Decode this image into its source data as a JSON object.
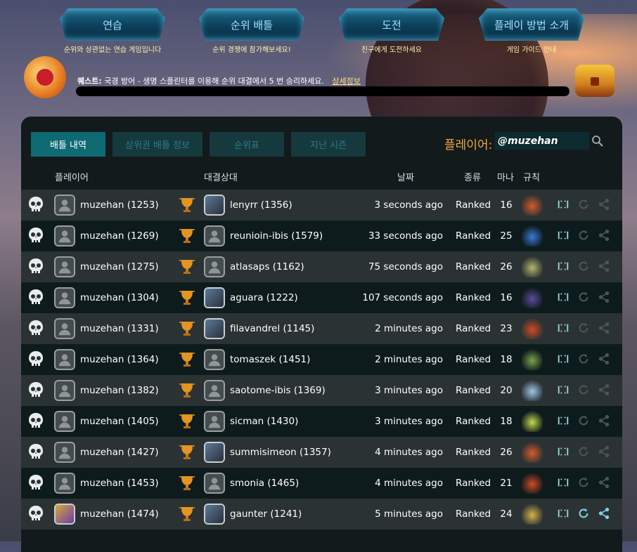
{
  "nav": [
    {
      "label": "연습",
      "sub": "순위와 상관없는 연습 게임입니다"
    },
    {
      "label": "순위 배틀",
      "sub": "순위 경쟁에 참가해보세요!"
    },
    {
      "label": "도전",
      "sub": "친구에게 도전하세요"
    },
    {
      "label": "플레이 방법 소개",
      "sub": "게임 가이드 안내"
    }
  ],
  "quest": {
    "prefix": "퀘스트:",
    "text": "국경 방어 - 생명 스플린터를 이용해 순위 대결에서 5 번 승리하세요.",
    "link": "상세정보"
  },
  "tabs": [
    "배틀 내역",
    "상위권 배틀 정보",
    "순위표",
    "지난 시즌"
  ],
  "player": {
    "label": "플레이어:",
    "value": "@muzehan"
  },
  "headers": {
    "player": "플레이어",
    "opponent": "대결상대",
    "date": "날짜",
    "type": "종류",
    "mana": "마나",
    "rules": "규칙"
  },
  "rows": [
    {
      "player": "muzehan (1253)",
      "opponent": "lenyrr (1356)",
      "date": "3 seconds ago",
      "type": "Ranked",
      "mana": "16",
      "rule_icon": "explosion-icon",
      "rule_color": "#d65a2c",
      "opp_avatar": "castle-avatar"
    },
    {
      "player": "muzehan (1269)",
      "opponent": "reunioin-ibis (1579)",
      "date": "33 seconds ago",
      "type": "Ranked",
      "mana": "25",
      "rule_icon": "cards-icon",
      "rule_color": "#3a7bd5",
      "opp_avatar": "default-avatar"
    },
    {
      "player": "muzehan (1275)",
      "opponent": "atlasaps (1162)",
      "date": "75 seconds ago",
      "type": "Ranked",
      "mana": "26",
      "rule_icon": "claw-icon",
      "rule_color": "#b8b36a",
      "opp_avatar": "default-avatar"
    },
    {
      "player": "muzehan (1304)",
      "opponent": "aguara (1222)",
      "date": "107 seconds ago",
      "type": "Ranked",
      "mana": "16",
      "rule_icon": "hooded-figure-icon",
      "rule_color": "#5e4a9c",
      "opp_avatar": "red-creature-avatar"
    },
    {
      "player": "muzehan (1331)",
      "opponent": "filavandrel (1145)",
      "date": "2 minutes ago",
      "type": "Ranked",
      "mana": "23",
      "rule_icon": "banner-icon",
      "rule_color": "#d34a22",
      "opp_avatar": "feather-avatar"
    },
    {
      "player": "muzehan (1364)",
      "opponent": "tomaszek (1451)",
      "date": "2 minutes ago",
      "type": "Ranked",
      "mana": "18",
      "rule_icon": "goblin-icon",
      "rule_color": "#7aa14a",
      "opp_avatar": "default-avatar"
    },
    {
      "player": "muzehan (1382)",
      "opponent": "saotome-ibis (1369)",
      "date": "3 minutes ago",
      "type": "Ranked",
      "mana": "20",
      "rule_icon": "horned-helmet-icon",
      "rule_color": "#9fc6e6",
      "opp_avatar": "default-avatar"
    },
    {
      "player": "muzehan (1405)",
      "opponent": "sicman (1430)",
      "date": "3 minutes ago",
      "type": "Ranked",
      "mana": "18",
      "rule_icon": "cloak-icon",
      "rule_color": "#c7d94a",
      "opp_avatar": "default-avatar"
    },
    {
      "player": "muzehan (1427)",
      "opponent": "summisimeon (1357)",
      "date": "4 minutes ago",
      "type": "Ranked",
      "mana": "26",
      "rule_icon": "explosion-icon",
      "rule_color": "#d65a2c",
      "opp_avatar": "person-avatar"
    },
    {
      "player": "muzehan (1453)",
      "opponent": "smonia (1465)",
      "date": "4 minutes ago",
      "type": "Ranked",
      "mana": "21",
      "rule_icon": "banner-icon",
      "rule_color": "#d34a22",
      "opp_avatar": "default-avatar"
    },
    {
      "player": "muzehan (1474)",
      "opponent": "gaunter (1241)",
      "date": "5 minutes ago",
      "type": "Ranked",
      "mana": "24",
      "rule_icon": "spiral-icon",
      "rule_color": "#d9b24a",
      "opp_avatar": "cartoon-avatar",
      "player_avatar": "warrior-avatar",
      "active": true
    }
  ],
  "colors": {
    "accent": "#0e6a73",
    "player_label": "#f0a940",
    "quest_link": "#ffe17a"
  }
}
